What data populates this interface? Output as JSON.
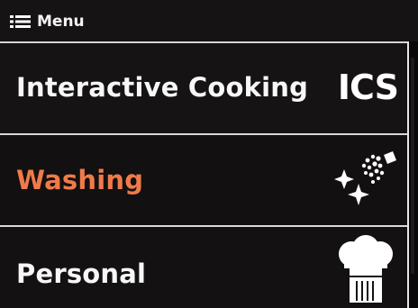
{
  "header": {
    "menu_label": "Menu",
    "menu_icon": "hamburger-menu-icon"
  },
  "menu": {
    "items": [
      {
        "label": "Interactive Cooking",
        "icon_name": "ics-icon",
        "icon_text": "ICS",
        "color": "#f7f7f7"
      },
      {
        "label": "Washing",
        "icon_name": "washing-spray-icon",
        "color": "#f07a4a",
        "selected": true
      },
      {
        "label": "Personal",
        "icon_name": "chef-hat-icon",
        "color": "#f7f7f7"
      }
    ]
  },
  "colors": {
    "background": "#121010",
    "accent": "#f07a4a",
    "divider": "#d9d9d9",
    "text": "#f7f7f7"
  }
}
